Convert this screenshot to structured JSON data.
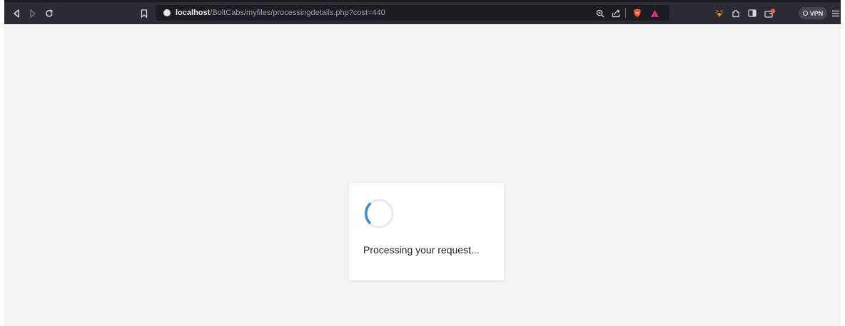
{
  "browser": {
    "url_host": "localhost",
    "url_path": "/BoltCabs/myfiles/processingdetails.php?cost=440",
    "vpn_label": "VPN",
    "accent_colors": {
      "toolbar": "#2b2c33",
      "brave_lion": "#fb542b",
      "rewards_triangle": "#ff2d55",
      "metamask": "#e2761b"
    },
    "icons": [
      "back-icon",
      "forward-icon",
      "reload-icon",
      "bookmark-icon",
      "site-info-icon",
      "zoom-icon",
      "share-icon",
      "brave-shields-icon",
      "brave-rewards-icon",
      "metamask-icon",
      "extensions-icon",
      "sidebar-icon",
      "wallet-icon",
      "vpn-icon",
      "menu-icon"
    ]
  },
  "page": {
    "message": "Processing your request...",
    "spinner_color": "#3d8fd1"
  }
}
